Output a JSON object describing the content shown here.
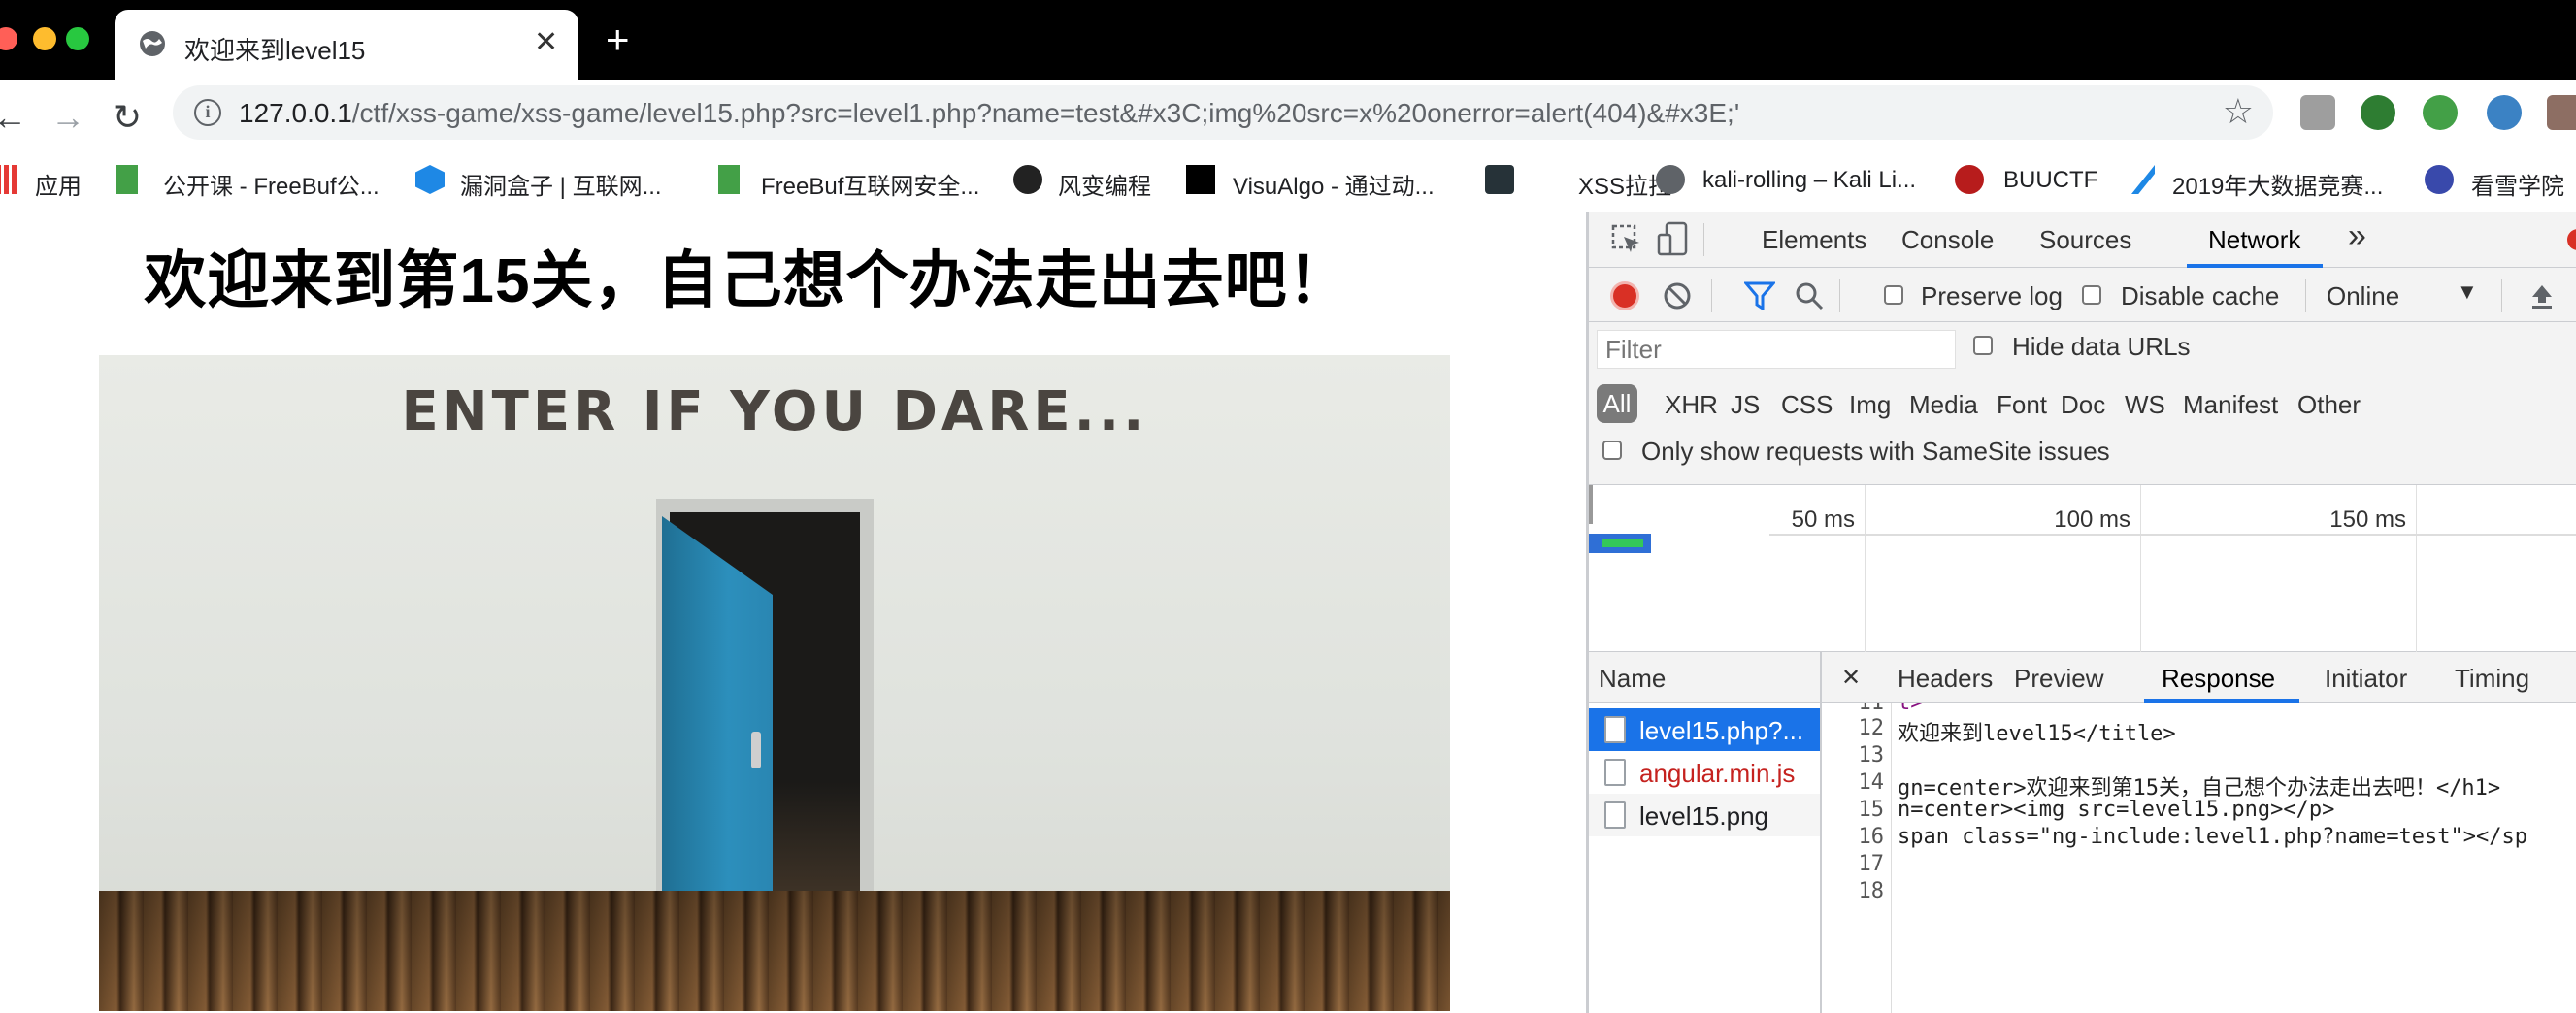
{
  "browser": {
    "tab": {
      "title": "欢迎来到level15",
      "close": "✕"
    },
    "new_tab": "+",
    "nav": {
      "back": "←",
      "forward": "→",
      "reload": "↻"
    },
    "url": {
      "host": "127.0.0.1",
      "path": "/ctf/xss-game/xss-game/level15.php?src=level1.php?name=test&#x3C;img%20src=x%20onerror=alert(404)&#x3E;'"
    },
    "star": "☆",
    "bookmarks": [
      {
        "label": "应用",
        "icon": "apps-grid-icon"
      },
      {
        "label": "公开课 - FreeBuf公...",
        "icon": "freebuf-icon"
      },
      {
        "label": "漏洞盒子 | 互联网...",
        "icon": "vulbox-icon"
      },
      {
        "label": "FreeBuf互联网安全...",
        "icon": "freebuf-icon"
      },
      {
        "label": "风变编程",
        "icon": "fengbian-icon"
      },
      {
        "label": "VisuAlgo - 通过动...",
        "icon": "visualgo-icon"
      },
      {
        "label": "XSS拉拉",
        "icon": "xss-icon"
      },
      {
        "label": "kali-rolling – Kali Li...",
        "icon": "globe-icon"
      },
      {
        "label": "BUUCTF",
        "icon": "buuctf-icon"
      },
      {
        "label": "2019年大数据竞赛...",
        "icon": "bigdata-icon"
      },
      {
        "label": "看雪学院",
        "icon": "kanxue-icon"
      }
    ]
  },
  "page": {
    "heading": "欢迎来到第15关，自己想个办法走出去吧！",
    "scene_text": "ENTER IF YOU DARE..."
  },
  "devtools": {
    "tabs": [
      "Elements",
      "Console",
      "Sources",
      "Network",
      "»"
    ],
    "active_tab": "Network",
    "preserve_log": "Preserve log",
    "disable_cache": "Disable cache",
    "throttling": "Online",
    "filter_placeholder": "Filter",
    "hide_data_urls": "Hide data URLs",
    "types": [
      "All",
      "XHR",
      "JS",
      "CSS",
      "Img",
      "Media",
      "Font",
      "Doc",
      "WS",
      "Manifest",
      "Other"
    ],
    "samesite": "Only show requests with SameSite issues",
    "ticks": [
      "50 ms",
      "100 ms",
      "150 ms"
    ],
    "name_header": "Name",
    "requests": [
      {
        "name": "level15.php?...",
        "color": "#ffffff",
        "selected": true
      },
      {
        "name": "angular.min.js",
        "color": "#c5221f",
        "selected": false
      },
      {
        "name": "level15.png",
        "color": "#202124",
        "selected": false
      }
    ],
    "resp_close": "✕",
    "resp_tabs": [
      "Headers",
      "Preview",
      "Response",
      "Initiator",
      "Timing"
    ],
    "active_resp_tab": "Response",
    "code_lines": [
      {
        "n": "11",
        "t": "t>"
      },
      {
        "n": "12",
        "t": "欢迎来到level15</title>"
      },
      {
        "n": "13",
        "t": ""
      },
      {
        "n": "14",
        "t": "gn=center>欢迎来到第15关，自己想个办法走出去吧！</h1>"
      },
      {
        "n": "15",
        "t": "n=center><img src=level15.png></p>"
      },
      {
        "n": "16",
        "t": "span class=\"ng-include:level1.php?name=test\"></sp"
      },
      {
        "n": "17",
        "t": ""
      },
      {
        "n": "18",
        "t": ""
      }
    ]
  }
}
